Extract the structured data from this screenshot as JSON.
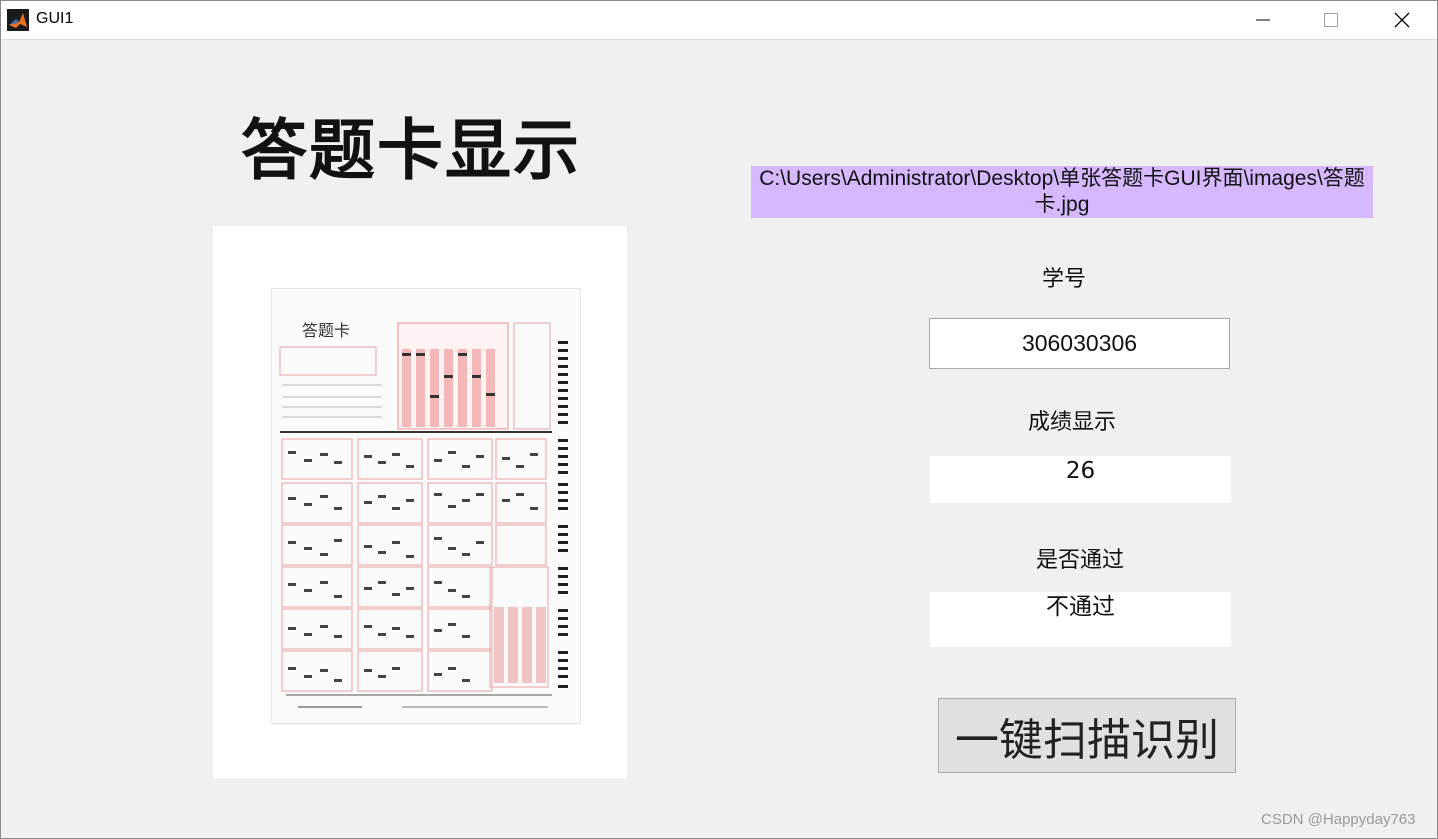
{
  "window": {
    "title": "GUI1",
    "icon": "matlab-logo-icon",
    "controls": [
      "minimize-icon",
      "maximize-icon",
      "close-icon"
    ]
  },
  "heading": "答题卡显示",
  "answer_sheet_image": {
    "title_text": "答题卡"
  },
  "file_path": "C:\\Users\\Administrator\\Desktop\\单张答题卡GUI界面\\images\\答题卡.jpg",
  "student_id": {
    "label": "学号",
    "value": "306030306"
  },
  "score": {
    "label": "成绩显示",
    "value": "26"
  },
  "pass": {
    "label": "是否通过",
    "value": "不通过"
  },
  "scan_button": "一键扫描识别",
  "watermark": "CSDN @Happyday763",
  "colors": {
    "background": "#f0f0f0",
    "path_highlight": "#d6b8ff",
    "button": "#e1e1e1"
  }
}
